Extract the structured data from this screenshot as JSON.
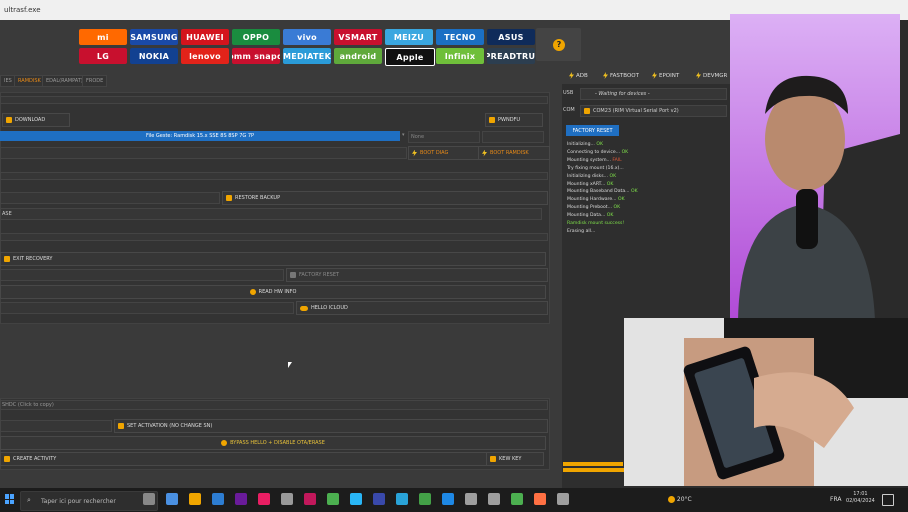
{
  "window": {
    "title": "ultrasf.exe"
  },
  "brands": [
    {
      "label": "mi",
      "color": "#ff6900"
    },
    {
      "label": "SAMSUNG",
      "color": "#1a4aa8"
    },
    {
      "label": "HUAWEI",
      "color": "#d4141d"
    },
    {
      "label": "OPPO",
      "color": "#1a8c3f"
    },
    {
      "label": "vivo",
      "color": "#3a7bd5"
    },
    {
      "label": "VSMART",
      "color": "#c8102e"
    },
    {
      "label": "MEIZU",
      "color": "#3aa7e0"
    },
    {
      "label": "TECNO",
      "color": "#1b6fc4"
    },
    {
      "label": "ASUS",
      "color": "#0f2b5a"
    },
    {
      "label": "LG",
      "color": "#c8102e"
    },
    {
      "label": "NOKIA",
      "color": "#124191"
    },
    {
      "label": "lenovo",
      "color": "#e2231a"
    },
    {
      "label": "Qualcomm snapdragon",
      "color": "#c8102e"
    },
    {
      "label": "MEDIATEK",
      "color": "#2a9bd8"
    },
    {
      "label": "android",
      "color": "#5fa93b"
    },
    {
      "label": "Apple",
      "color": "#111111"
    },
    {
      "label": "Infinix",
      "color": "#6fbf3a"
    },
    {
      "label": "SPREADTRUM",
      "color": "#2c3e50"
    }
  ],
  "help_label": "?",
  "tabs": [
    "IES",
    "RAMDISK",
    "EDAL(RAMPAT)",
    "FRODE"
  ],
  "toolbar_top": {
    "adb": "ADB",
    "fastboot": "FASTBOOT",
    "edl": "EPOINT",
    "devmode": "DEVMGR"
  },
  "main": {
    "download_btn": "DOWNLOAD",
    "pwnd_btn": "PWNDFU",
    "file_select": "File Geste: Ramdisk 15.x SSE 8S 8SP 7G 7P",
    "dropdown_none": "None",
    "boot_diag": "BOOT DIAG",
    "boot_ramdisk": "BOOT RAMDISK",
    "restore_backup": "RESTORE BACKUP",
    "row_label_ase": "ASE",
    "exit_recovery": "EXIT RECOVERY",
    "factory_reset_main": "FACTORY RESET",
    "read_hw_info": "READ HW INFO",
    "hello_icloud": "HELLO ICLOUD",
    "click_to_copy": "SHDC (Click to copy)",
    "set_activation": "SET ACTIVATION (NO CHANGE SN)",
    "bypass_hello": "BYPASS HELLO + DISABLE OTA/ERASE",
    "create_activity": "CREATE ACTIVITY",
    "key_btn": "KEW KEY"
  },
  "right": {
    "usb_label": "USB",
    "usb_value": "- Waiting for devices -",
    "com_label": "COM",
    "com_value": "COM23 (RIM Virtual Serial Port v2)",
    "factory_reset": "FACTORY RESET",
    "log": [
      {
        "text": "Initializing... ",
        "status": "OK",
        "type": "ok"
      },
      {
        "text": "Connecting to device... ",
        "status": "OK",
        "type": "ok"
      },
      {
        "text": "Mounting system... ",
        "status": "FAIL",
        "type": "fail"
      },
      {
        "text": "Try fixing mount (16.x)... ",
        "status": "",
        "type": "ok"
      },
      {
        "text": "Initializing disks... ",
        "status": "OK",
        "type": "ok"
      },
      {
        "text": "Mounting xART... ",
        "status": "OK",
        "type": "ok"
      },
      {
        "text": "Mounting Baseband Data... ",
        "status": "OK",
        "type": "ok"
      },
      {
        "text": "Mounting Hardware... ",
        "status": "OK",
        "type": "ok"
      },
      {
        "text": "Mounting Preboot... ",
        "status": "OK",
        "type": "ok"
      },
      {
        "text": "Mounting Data... ",
        "status": "OK",
        "type": "ok"
      },
      {
        "text": "Ramdisk mount success!",
        "status": "",
        "type": "ok"
      },
      {
        "text": "Erasing all...",
        "status": "",
        "type": "plain"
      }
    ]
  },
  "taskbar": {
    "search_placeholder": "Taper ici pour rechercher",
    "weather": "20°C",
    "lang": "FRA",
    "time": "17:01",
    "date": "02/04/2024"
  },
  "colors": {
    "accent_blue": "#1f6fc2",
    "accent_orange": "#f0a500"
  }
}
